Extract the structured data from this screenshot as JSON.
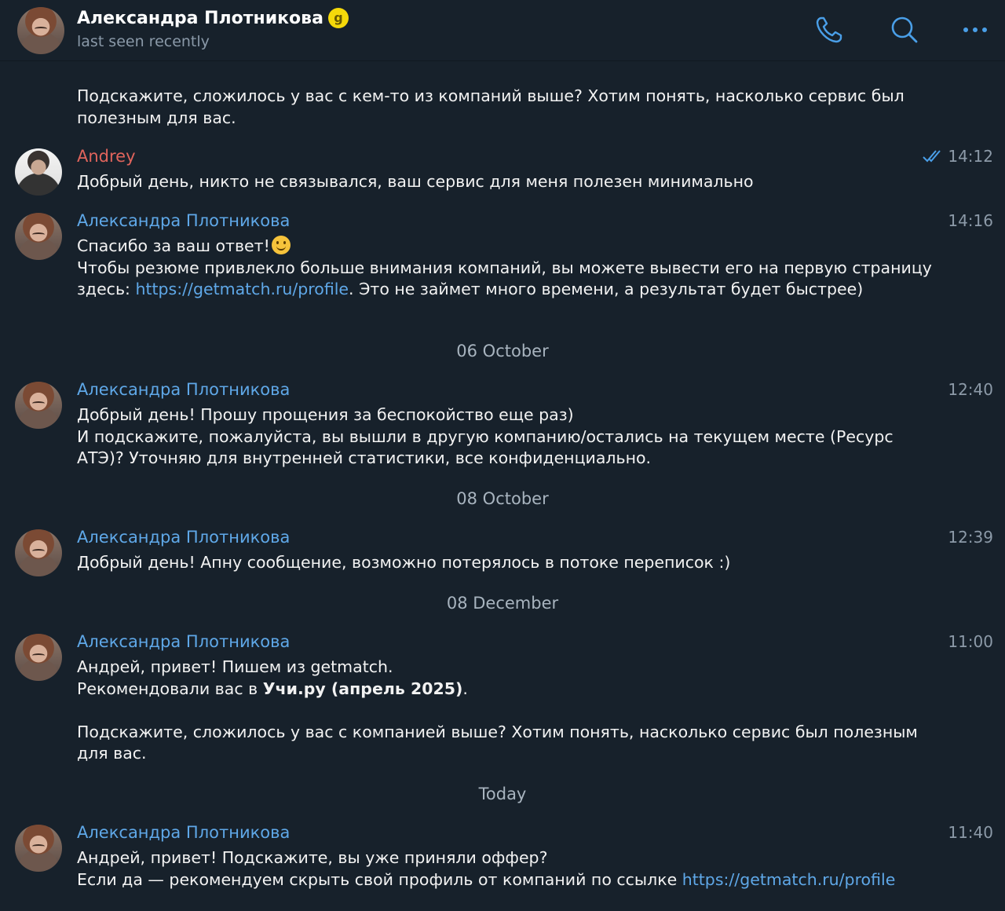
{
  "header": {
    "contact_name": "Александра Плотникова",
    "badge_letter": "g",
    "status": "last seen recently",
    "icons": [
      "phone-icon",
      "search-icon",
      "more-icon"
    ],
    "accent_color": "#4a9fe8"
  },
  "messages": [
    {
      "text": "Подскажите, сложилось у вас с кем-то из компаний выше? Хотим понять, насколько сервис был полезным для вас."
    },
    {
      "sender": "Andrey",
      "time": "14:12",
      "read_status": "double-check-icon",
      "text": "Добрый день, никто не связывался, ваш сервис для меня полезен минимально"
    },
    {
      "sender": "Александра Плотникова",
      "time": "14:16",
      "line1": "Спасибо за ваш ответ!",
      "line2": "Чтобы резюме привлекло больше внимания компаний, вы можете вывести его на первую страницу здесь: ",
      "link": "https://getmatch.ru/profile",
      "line2_tail": ". Это не займет много времени, а результат будет быстрее)"
    },
    {
      "sender": "Александра Плотникова",
      "time": "12:40",
      "text": "Добрый день! Прошу прощения за беспокойство еще раз)\nИ подскажите, пожалуйста, вы вышли в другую компанию/остались на текущем месте (Ресурс АТЭ)? Уточняю для внутренней статистики, все конфиденциально."
    },
    {
      "sender": "Александра Плотникова",
      "time": "12:39",
      "text": "Добрый день! Апну сообщение, возможно потерялось в потоке переписок :)"
    },
    {
      "sender": "Александра Плотникова",
      "time": "11:00",
      "line1": "Андрей, привет! Пишем из getmatch.",
      "line2_prefix": "Рекомендовали вас в ",
      "line2_bold": "Учи.ру (апрель 2025)",
      "line2_suffix": ".",
      "line3": "Подскажите, сложилось у вас с компанией выше? Хотим понять, насколько сервис был полезным для вас."
    },
    {
      "sender": "Александра Плотникова",
      "time": "11:40",
      "line1": "Андрей, привет! Подскажите, вы уже приняли оффер?",
      "line2": "Если да — рекомендуем скрыть свой профиль от компаний по ссылке ",
      "link": "https://getmatch.ru/profile"
    }
  ],
  "date_separators": [
    "06 October",
    "08 October",
    "08 December",
    "Today"
  ]
}
